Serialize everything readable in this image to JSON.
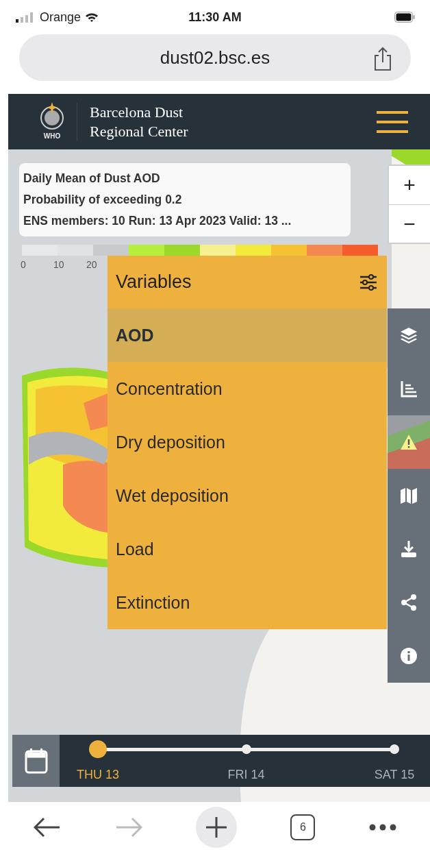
{
  "status_bar": {
    "carrier": "Orange",
    "time": "11:30 AM"
  },
  "url_bar": {
    "address": "dust02.bsc.es"
  },
  "site_header": {
    "logo_text": "WHO",
    "title_lines": [
      "Barcelona Dust",
      "Regional Center"
    ]
  },
  "map_info": {
    "lines": [
      "Daily Mean of Dust AOD",
      "Probability of exceeding 0.2",
      "ENS members: 10 Run: 13 Apr 2023 Valid: 13 ..."
    ]
  },
  "zoom_controls": [
    "+",
    "−"
  ],
  "legend": {
    "segments": [
      {
        "color": "#e6e8ea"
      },
      {
        "color": "#e0e2e4"
      },
      {
        "color": "#c9cacb"
      },
      {
        "color": "#b5ef3c"
      },
      {
        "color": "#9ad92c"
      },
      {
        "color": "#f6f08e"
      },
      {
        "color": "#f2eb3c"
      },
      {
        "color": "#f5c232"
      },
      {
        "color": "#f58952"
      },
      {
        "color": "#f55b2b"
      }
    ],
    "ticks": [
      "0",
      "10",
      "20"
    ]
  },
  "variables_panel": {
    "title": "Variables",
    "items": [
      {
        "label": "AOD",
        "selected": true
      },
      {
        "label": "Concentration",
        "selected": false
      },
      {
        "label": "Dry deposition",
        "selected": false
      },
      {
        "label": "Wet deposition",
        "selected": false
      },
      {
        "label": "Load",
        "selected": false
      },
      {
        "label": "Extinction",
        "selected": false
      }
    ]
  },
  "timeline": {
    "days": [
      {
        "label": "THU 13",
        "selected": true
      },
      {
        "label": "FRI 14",
        "selected": false
      },
      {
        "label": "SAT 15",
        "selected": false
      }
    ]
  },
  "browser_nav": {
    "forward_disabled": true,
    "tab_count": "6"
  }
}
